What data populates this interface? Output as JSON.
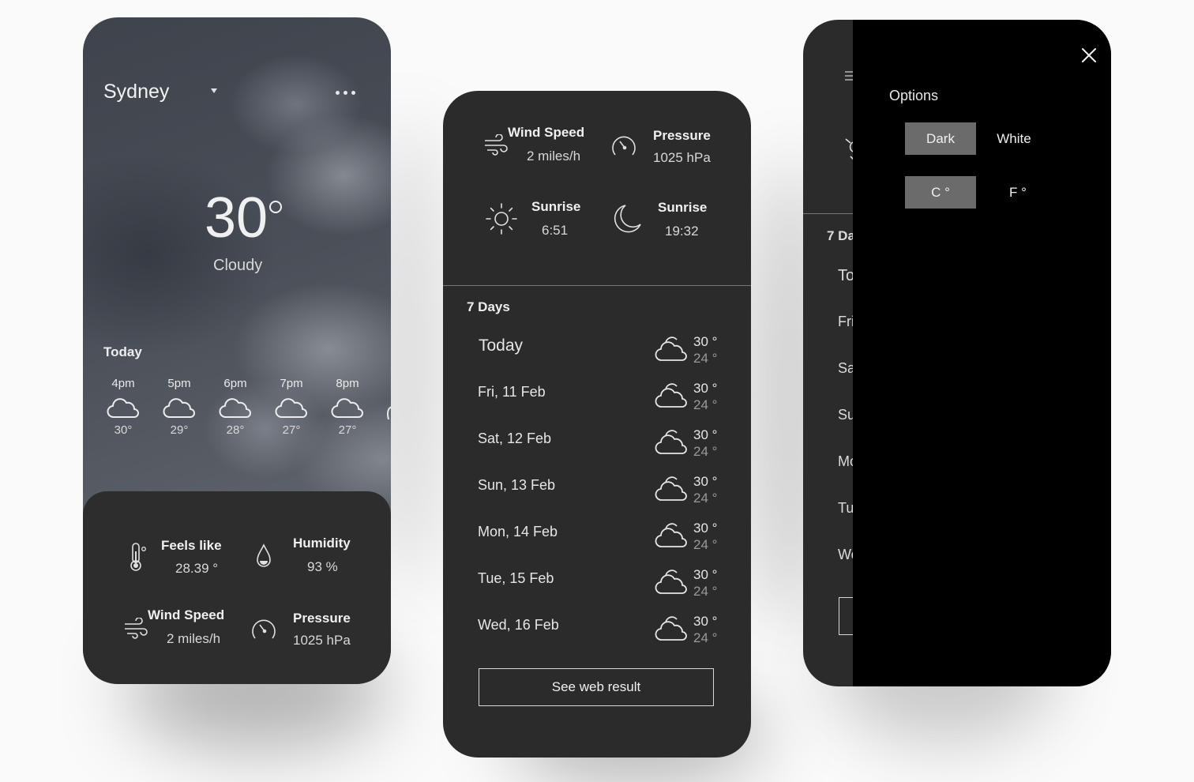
{
  "phone1": {
    "city": "Sydney",
    "temperature": "30",
    "condition": "Cloudy",
    "today_label": "Today",
    "hourly": [
      {
        "time": "4pm",
        "temp": "30°"
      },
      {
        "time": "5pm",
        "temp": "29°"
      },
      {
        "time": "6pm",
        "temp": "28°"
      },
      {
        "time": "7pm",
        "temp": "27°"
      },
      {
        "time": "8pm",
        "temp": "27°"
      }
    ],
    "stats": {
      "feels_like_label": "Feels like",
      "feels_like_value": "28.39 °",
      "humidity_label": "Humidity",
      "humidity_value": "93 %",
      "wind_label": "Wind Speed",
      "wind_value": "2 miles/h",
      "pressure_label": "Pressure",
      "pressure_value": "1025 hPa"
    }
  },
  "phone2": {
    "wind_label": "Wind Speed",
    "wind_value": "2 miles/h",
    "pressure_label": "Pressure",
    "pressure_value": "1025 hPa",
    "sunrise_label": "Sunrise",
    "sunrise_value": "6:51",
    "sunset_label": "Sunrise",
    "sunset_value": "19:32",
    "days_title": "7 Days",
    "days": [
      {
        "name": "Today",
        "hi": "30 °",
        "lo": "24 °"
      },
      {
        "name": "Fri, 11 Feb",
        "hi": "30 °",
        "lo": "24 °"
      },
      {
        "name": "Sat, 12 Feb",
        "hi": "30 °",
        "lo": "24 °"
      },
      {
        "name": "Sun, 13 Feb",
        "hi": "30 °",
        "lo": "24 °"
      },
      {
        "name": "Mon, 14 Feb",
        "hi": "30 °",
        "lo": "24 °"
      },
      {
        "name": "Tue, 15 Feb",
        "hi": "30 °",
        "lo": "24 °"
      },
      {
        "name": "Wed, 16 Feb",
        "hi": "30 °",
        "lo": "24 °"
      }
    ],
    "web_button": "See web result"
  },
  "phone3": {
    "under_days_title": "7 Da",
    "under_days": [
      "To",
      "Fri",
      "Sa",
      "Su",
      "Mo",
      "Tu",
      "We"
    ],
    "options_title": "Options",
    "theme_dark": "Dark",
    "theme_white": "White",
    "unit_c": "C °",
    "unit_f": "F °"
  },
  "icons": [
    "caret-down-icon",
    "more-icon",
    "cloud-icon",
    "thermometer-icon",
    "drop-icon",
    "wind-icon",
    "gauge-icon",
    "sun-icon",
    "moon-icon",
    "menu-icon",
    "close-icon"
  ]
}
